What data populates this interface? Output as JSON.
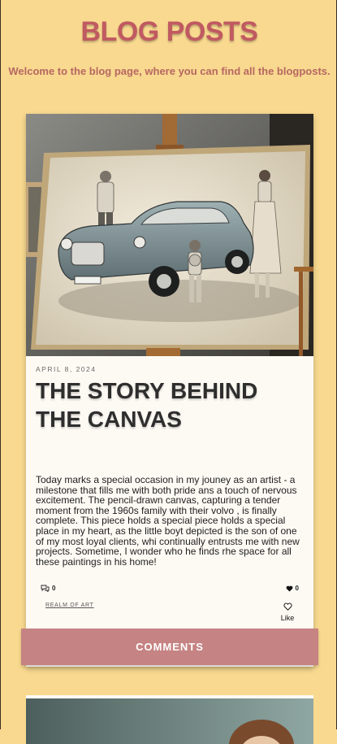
{
  "header": {
    "title": "BLOG POSTS",
    "subtitle": "Welcome to the blog page, where you can find all the blogposts."
  },
  "post": {
    "date": "APRIL 8, 2024",
    "title": "THE STORY BEHIND THE CANVAS",
    "body": "Today marks a special occasion in my jouney as an artist - a milestone that fills me with both pride ans a touch of nervous excitement. The pencil-drawn canvas, capturing a tender moment from the 1960s family with their volvo , is finally complete.  This piece holds a special piece holds a special place in my heart, as the little boyt depicted is the son of one of my most loyal clients, whi continually entrusts me with new projects. Sometime, I wonder who he finds rhe space for all these paintings in his home!",
    "comment_count": "0",
    "like_count": "0",
    "category": "REALM OF ART",
    "like_label": "Like",
    "comments_button": "COMMENTS",
    "image_icon": "pencil-drawing-family-volvo"
  },
  "colors": {
    "background": "#f8d98f",
    "title": "#c05a61",
    "comments_button": "#c68383",
    "card": "#fdfaf4"
  }
}
